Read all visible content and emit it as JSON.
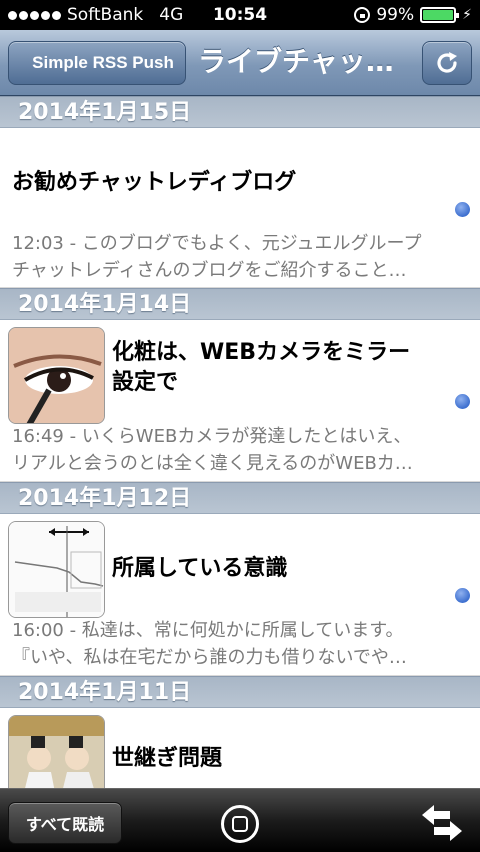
{
  "status_bar": {
    "carrier": "SoftBank",
    "network": "4G",
    "time": "10:54",
    "battery": "99%",
    "battery_level": 0.99,
    "signal_bars": 5
  },
  "nav": {
    "back_label": "Simple RSS Push",
    "title": "ライブチャッ…",
    "refresh_icon": "refresh-icon"
  },
  "sections": [
    {
      "date": "2014年1月15日",
      "item": {
        "title": "お勧めチャットレディブログ",
        "desc_line1": "12:03 - このブログでもよく、元ジュエルグループ",
        "desc_line2": "チャットレディさんのブログをご紹介すること…",
        "unread": true
      }
    },
    {
      "date": "2014年1月14日",
      "item": {
        "title_line1": "化粧は、WEBカメラをミラー",
        "title_line2": "設定で",
        "desc_line1": "16:49 - いくらWEBカメラが発達したとはいえ、",
        "desc_line2": "リアルと会うのとは全く違く見えるのがWEBカ…",
        "unread": true,
        "thumbnail": "eye-makeup-photo"
      }
    },
    {
      "date": "2014年1月12日",
      "item": {
        "title": "所属している意識",
        "desc_line1": "16:00 - 私達は、常に何処かに所属しています。",
        "desc_line2": "『いや、私は在宅だから誰の力も借りないでや…",
        "unread": true,
        "thumbnail": "chart-screenshot"
      }
    },
    {
      "date": "2014年1月11日",
      "item": {
        "title": "世継ぎ問題",
        "thumbnail": "portrait-painting"
      }
    }
  ],
  "toolbar": {
    "mark_all_read": "すべて既読",
    "home_icon": "home-circle-icon",
    "swap_icon": "swap-arrows-icon"
  },
  "colors": {
    "unread_dot": "#3d6fcf",
    "nav_bar": "#7f98b7",
    "section_header": "#b0bdcc"
  }
}
